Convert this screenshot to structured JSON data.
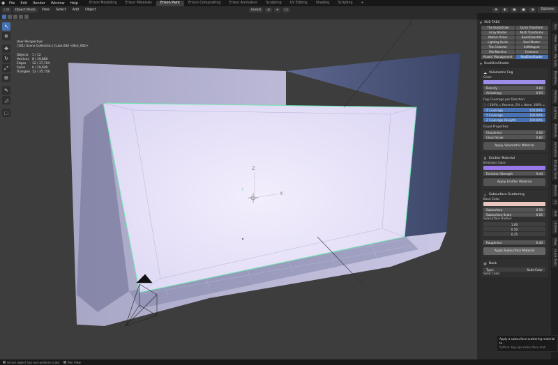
{
  "menubar": {
    "menus": [
      "File",
      "Edit",
      "Render",
      "Window",
      "Help"
    ],
    "workspaces": [
      "Erison Modelling",
      "Erison Materials",
      "Erison Paint",
      "Erison Compositing",
      "Erison Animation",
      "Sculpting",
      "UV Editing",
      "Shading",
      "Scripting"
    ],
    "active_workspace": "Erison Paint",
    "add_tab": "+"
  },
  "header": {
    "mode": "Object Mode",
    "menus": [
      "View",
      "Select",
      "Add",
      "Object"
    ],
    "orientation": "Global",
    "options": "Options"
  },
  "viewport": {
    "view_name": "User Perspective",
    "collection": "(101) Scene Collection | Cube.044 <Bkd_002>",
    "stats": [
      {
        "label": "Objects",
        "value": "1 / 12"
      },
      {
        "label": "Vertices",
        "value": "8 / 19,880"
      },
      {
        "label": "Edges",
        "value": "12 / 37,704"
      },
      {
        "label": "Faces",
        "value": "6 / 19,600"
      },
      {
        "label": "Triangles",
        "value": "12 / 35,758"
      }
    ],
    "axis_z": "Z",
    "axis_x": "X",
    "axis_y": "Y"
  },
  "panel": {
    "subtabs_title": "SUB TABS",
    "subtabs": [
      {
        "label": "The QuickDraw",
        "active": false
      },
      {
        "label": "Quick Transform",
        "active": false
      },
      {
        "label": "Array Master",
        "active": false
      },
      {
        "label": "Multi Transforms",
        "active": false
      },
      {
        "label": "Mother Picker",
        "active": false
      },
      {
        "label": "BoolsDizentAd",
        "active": false
      },
      {
        "label": "Lighting Quick",
        "active": false
      },
      {
        "label": "Roof Master",
        "active": false
      },
      {
        "label": "The Collector",
        "active": false
      },
      {
        "label": "SoftMagnet",
        "active": false
      },
      {
        "label": "Mix Machine",
        "active": false
      },
      {
        "label": "Cartoonic",
        "active": false
      },
      {
        "label": "Assets' Management",
        "active": false
      },
      {
        "label": "RealSlimShader",
        "active": true
      }
    ],
    "shader_title": "RealSlimShader",
    "volumetric": {
      "title": "Volumetric Fog",
      "color_label": "Color:",
      "color": "#9b8ee8",
      "density_label": "Density",
      "density": "0.80",
      "anisotropy_label": "Anisotropy",
      "anisotropy": "0.03",
      "coverage_title": "Fog Coverage per Direction:",
      "coverage_note": "(-100% = Reverse, 0% = None, 100% =",
      "x_label": "X Coverage",
      "x_value": "100.00%",
      "y_label": "Y Coverage",
      "y_value": "100.00%",
      "z_label": "Z Coverage (Height)",
      "z_value": "100.00%",
      "cloud_title": "Cloud Properties:",
      "cloudiness_label": "Cloudiness",
      "cloudiness": "0.00",
      "cloud_scale_label": "Cloud Scale",
      "cloud_scale": "0.82",
      "apply": "Apply Volumetric Material"
    },
    "emitter": {
      "title": "Emitter Material",
      "color_label": "Emission Color:",
      "color": "#9b78e8",
      "strength_label": "Emission Strength",
      "strength": "9.44",
      "apply": "Apply Emitter Material"
    },
    "subsurface": {
      "title": "Subsurface Scattering",
      "color_label": "Base Color:",
      "color": "#e9c6be",
      "subsurface_label": "Subsurface",
      "subsurface": "0.50",
      "scale_label": "Subsurface Scale",
      "scale": "0.05",
      "radius_label": "Subsurface Radius:",
      "radius": [
        "1.00",
        "0.50",
        "0.25"
      ],
      "roughness_label": "Roughness",
      "roughness": "0.40",
      "apply": "Apply Subsurface Material"
    },
    "background": {
      "title": "Back",
      "type_label": "Type:",
      "type_value": "Solid Color",
      "solid_label": "Solid Color:"
    }
  },
  "right_tabs": [
    "Tool",
    "View",
    "Item",
    "My Tools",
    "Modeling",
    "Painting",
    "Lighting",
    "Materials",
    "Animation",
    "Display Tools",
    "Neuron",
    "FX",
    "Text",
    "Utilities",
    "View",
    "Quick Tools"
  ],
  "tooltip": {
    "text": "Apply a subsurface scattering material to",
    "python": "Python: bpy.ops.subsurface.mat..."
  },
  "statusbar": {
    "left": "Active object has non-uniform scale",
    "right": "Pan View"
  }
}
